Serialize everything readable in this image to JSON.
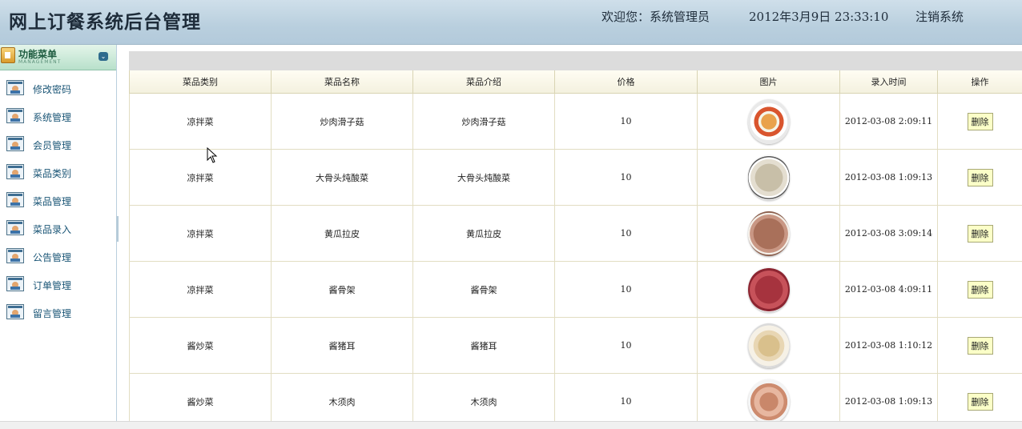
{
  "header": {
    "title": "网上订餐系统后台管理",
    "welcome": "欢迎您：系统管理员",
    "datetime": "2012年3月9日 23:33:10",
    "logout": "注销系统"
  },
  "sidebar": {
    "menu_title": "功能菜单",
    "menu_subtitle": "MANAGEMENT",
    "items": [
      {
        "label": "修改密码"
      },
      {
        "label": "系统管理"
      },
      {
        "label": "会员管理"
      },
      {
        "label": "菜品类别"
      },
      {
        "label": "菜品管理"
      },
      {
        "label": "菜品录入"
      },
      {
        "label": "公告管理"
      },
      {
        "label": "订单管理"
      },
      {
        "label": "留言管理"
      }
    ]
  },
  "table": {
    "headers": [
      "菜品类别",
      "菜品名称",
      "菜品介绍",
      "价格",
      "图片",
      "录入时间",
      "操作"
    ],
    "rows": [
      {
        "category": "凉拌菜",
        "name": "炒肉滑子菇",
        "intro": "炒肉滑子菇",
        "price": "10",
        "time": "2012-03-08 2:09:11",
        "action": "删除"
      },
      {
        "category": "凉拌菜",
        "name": "大骨头炖酸菜",
        "intro": "大骨头炖酸菜",
        "price": "10",
        "time": "2012-03-08 1:09:13",
        "action": "删除"
      },
      {
        "category": "凉拌菜",
        "name": "黄瓜拉皮",
        "intro": "黄瓜拉皮",
        "price": "10",
        "time": "2012-03-08 3:09:14",
        "action": "删除"
      },
      {
        "category": "凉拌菜",
        "name": "酱骨架",
        "intro": "酱骨架",
        "price": "10",
        "time": "2012-03-08 4:09:11",
        "action": "删除"
      },
      {
        "category": "酱炒菜",
        "name": "酱猪耳",
        "intro": "酱猪耳",
        "price": "10",
        "time": "2012-03-08 1:10:12",
        "action": "删除"
      },
      {
        "category": "酱炒菜",
        "name": "木须肉",
        "intro": "木须肉",
        "price": "10",
        "time": "2012-03-08 1:09:13",
        "action": "删除"
      }
    ]
  },
  "colors": {
    "header_bg": "#b9cfde",
    "menu_text": "#1a5576",
    "delete_button_bg": "#fbffc8"
  }
}
